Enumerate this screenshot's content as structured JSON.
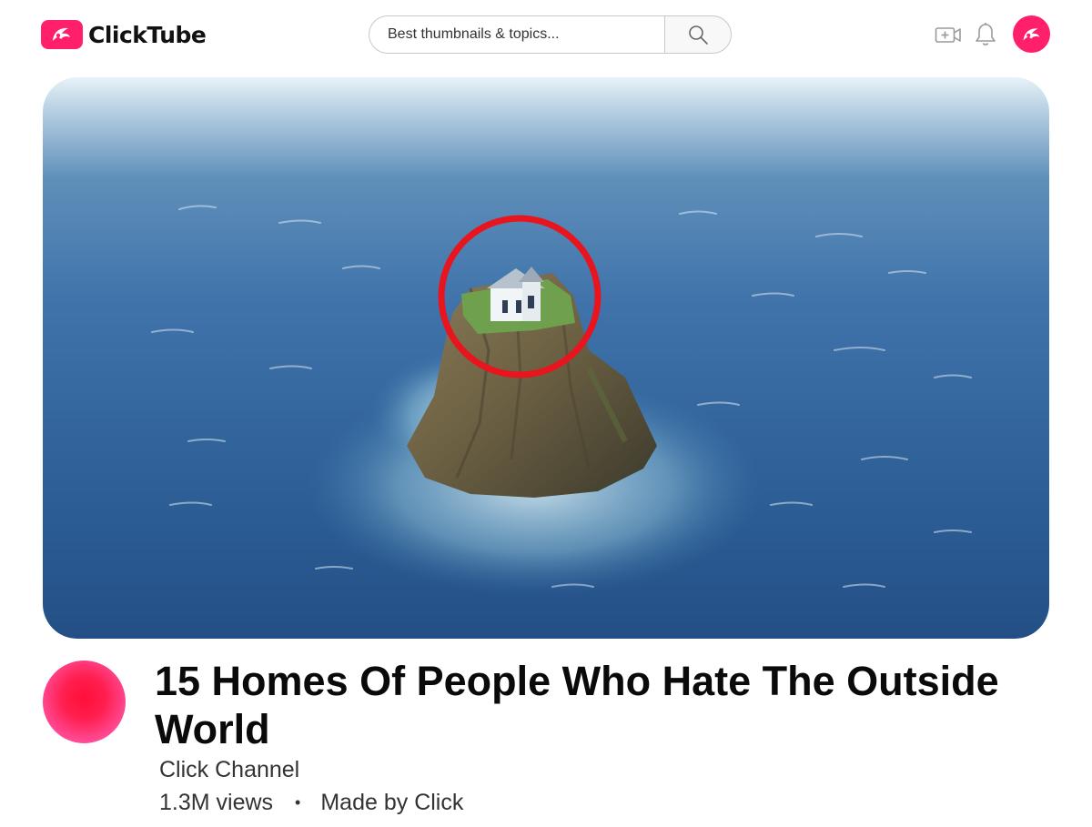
{
  "app": {
    "name": "ClickTube",
    "brand_color": "#ff1f6b"
  },
  "header": {
    "search_placeholder": "Best thumbnails & topics...",
    "icons": [
      "logo-mark",
      "search-icon",
      "create-video-icon",
      "bell-icon",
      "avatar"
    ]
  },
  "video": {
    "title": "15 Homes Of People Who Hate The Outside World",
    "channel": "Click Channel",
    "views": "1.3M views",
    "separator": "•",
    "made_by": "Made by Click"
  }
}
